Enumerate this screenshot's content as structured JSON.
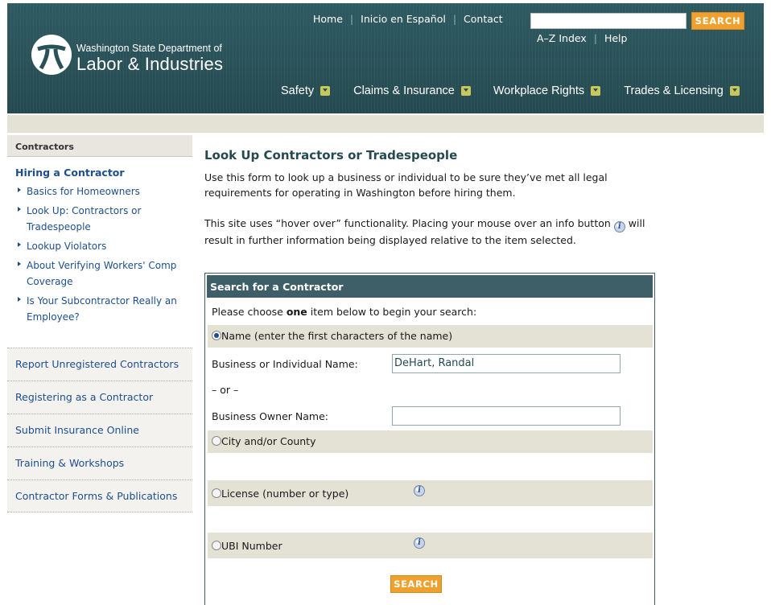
{
  "header": {
    "agency_line1": "Washington State Department of",
    "agency_line2": "Labor & Industries",
    "top_links": [
      "Home",
      "Inicio en Español",
      "Contact"
    ],
    "util_links": [
      "A–Z Index",
      "Help"
    ],
    "search_button": "SEARCH",
    "search_value": "",
    "nav": [
      "Safety",
      "Claims & Insurance",
      "Workplace Rights",
      "Trades & Licensing"
    ]
  },
  "sidebar": {
    "section_title": "Contractors",
    "active_item": "Hiring a Contractor",
    "sub_items": [
      "Basics for Homeowners",
      "Look Up: Contractors or Tradespeople",
      "Lookup Violators",
      "About Verifying Workers' Comp Coverage",
      "Is Your Subcontractor Really an Employee?"
    ],
    "links": [
      "Report Unregistered Contractors",
      "Registering as a Contractor",
      "Submit Insurance Online",
      "Training & Workshops",
      "Contractor Forms & Publications"
    ]
  },
  "main": {
    "title": "Look Up Contractors or Tradespeople",
    "intro": "Use this form to look up a business or individual to be sure they’ve met all legal requirements for operating in Washington before hiring them.",
    "hover_text_before": "This site uses “hover over” functionality. Placing your mouse over an info button",
    "hover_text_after": "will result in further information being displayed relative to the item selected."
  },
  "form": {
    "header": "Search for a Contractor",
    "instruction_before": "Please choose ",
    "instruction_bold": "one",
    "instruction_after": " item below to begin your search:",
    "option_name": "Name (enter the first characters of the name)",
    "business_name_label": "Business or Individual Name:",
    "business_name_value": "DeHart, Randal",
    "or_text": "– or –",
    "owner_name_label": "Business Owner Name:",
    "owner_name_value": "",
    "option_city": "City and/or County",
    "option_license": "License (number or type)",
    "option_ubi": "UBI Number",
    "selected_option": "name",
    "submit_label": "SEARCH"
  }
}
